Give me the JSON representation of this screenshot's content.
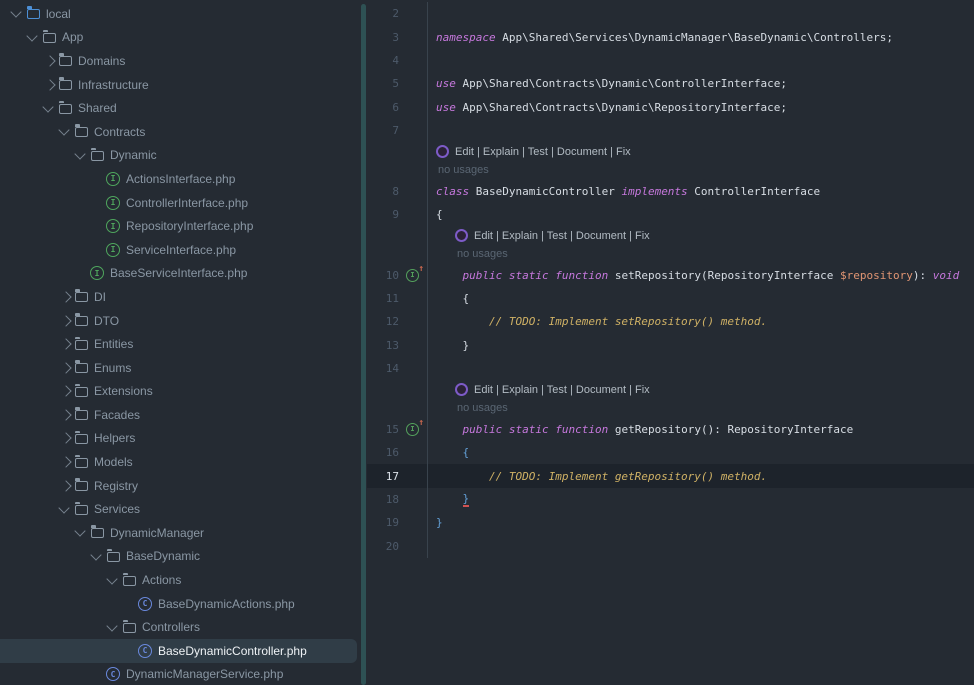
{
  "colors": {
    "background": "#252b33",
    "selection_row": "#303d47",
    "current_line": "#1d232b",
    "keyword": "#c678dd",
    "plain_code": "#d7dde4",
    "todo_comment": "#cfb165",
    "variable": "#e09573",
    "matched_brace": "#64a1d8",
    "error_underline": "#d15252",
    "interface_icon": "#4fa65d",
    "class_icon": "#6a89dd",
    "blue_folder": "#4c8fd6",
    "splitter": "#2e5154"
  },
  "project_tree": {
    "items": [
      {
        "label": "local",
        "kind": "folder",
        "icon": "folder-blue",
        "level": 0,
        "state": "expanded",
        "selected": false
      },
      {
        "label": "App",
        "kind": "folder",
        "icon": "folder",
        "level": 1,
        "state": "expanded",
        "selected": false
      },
      {
        "label": "Domains",
        "kind": "folder",
        "icon": "folder",
        "level": 2,
        "state": "collapsed",
        "selected": false
      },
      {
        "label": "Infrastructure",
        "kind": "folder",
        "icon": "folder",
        "level": 2,
        "state": "collapsed",
        "selected": false
      },
      {
        "label": "Shared",
        "kind": "folder",
        "icon": "folder",
        "level": 2,
        "state": "expanded",
        "selected": false
      },
      {
        "label": "Contracts",
        "kind": "folder",
        "icon": "folder",
        "level": 3,
        "state": "expanded",
        "selected": false
      },
      {
        "label": "Dynamic",
        "kind": "folder",
        "icon": "folder",
        "level": 4,
        "state": "expanded",
        "selected": false
      },
      {
        "label": "ActionsInterface.php",
        "kind": "file",
        "icon": "interface",
        "level": 5,
        "selected": false
      },
      {
        "label": "ControllerInterface.php",
        "kind": "file",
        "icon": "interface",
        "level": 5,
        "selected": false
      },
      {
        "label": "RepositoryInterface.php",
        "kind": "file",
        "icon": "interface",
        "level": 5,
        "selected": false
      },
      {
        "label": "ServiceInterface.php",
        "kind": "file",
        "icon": "interface",
        "level": 5,
        "selected": false
      },
      {
        "label": "BaseServiceInterface.php",
        "kind": "file",
        "icon": "interface",
        "level": 4,
        "selected": false
      },
      {
        "label": "DI",
        "kind": "folder",
        "icon": "folder",
        "level": 3,
        "state": "collapsed",
        "selected": false
      },
      {
        "label": "DTO",
        "kind": "folder",
        "icon": "folder",
        "level": 3,
        "state": "collapsed",
        "selected": false
      },
      {
        "label": "Entities",
        "kind": "folder",
        "icon": "folder",
        "level": 3,
        "state": "collapsed",
        "selected": false
      },
      {
        "label": "Enums",
        "kind": "folder",
        "icon": "folder",
        "level": 3,
        "state": "collapsed",
        "selected": false
      },
      {
        "label": "Extensions",
        "kind": "folder",
        "icon": "folder",
        "level": 3,
        "state": "collapsed",
        "selected": false
      },
      {
        "label": "Facades",
        "kind": "folder",
        "icon": "folder",
        "level": 3,
        "state": "collapsed",
        "selected": false
      },
      {
        "label": "Helpers",
        "kind": "folder",
        "icon": "folder",
        "level": 3,
        "state": "collapsed",
        "selected": false
      },
      {
        "label": "Models",
        "kind": "folder",
        "icon": "folder",
        "level": 3,
        "state": "collapsed",
        "selected": false
      },
      {
        "label": "Registry",
        "kind": "folder",
        "icon": "folder",
        "level": 3,
        "state": "collapsed",
        "selected": false
      },
      {
        "label": "Services",
        "kind": "folder",
        "icon": "folder",
        "level": 3,
        "state": "expanded",
        "selected": false
      },
      {
        "label": "DynamicManager",
        "kind": "folder",
        "icon": "folder",
        "level": 4,
        "state": "expanded",
        "selected": false
      },
      {
        "label": "BaseDynamic",
        "kind": "folder",
        "icon": "folder",
        "level": 5,
        "state": "expanded",
        "selected": false
      },
      {
        "label": "Actions",
        "kind": "folder",
        "icon": "folder",
        "level": 6,
        "state": "expanded",
        "selected": false
      },
      {
        "label": "BaseDynamicActions.php",
        "kind": "file",
        "icon": "class",
        "level": 7,
        "selected": false
      },
      {
        "label": "Controllers",
        "kind": "folder",
        "icon": "folder",
        "level": 6,
        "state": "expanded",
        "selected": false
      },
      {
        "label": "BaseDynamicController.php",
        "kind": "file",
        "icon": "class",
        "level": 7,
        "selected": true
      },
      {
        "label": "DynamicManagerService.php",
        "kind": "file",
        "icon": "class",
        "level": 5,
        "selected": false
      }
    ]
  },
  "editor": {
    "ai_actions_hint": "Edit | Explain | Test | Document | Fix",
    "usages_hint": "no usages",
    "rows": [
      {
        "kind": "code",
        "num": "2",
        "tokens": []
      },
      {
        "kind": "code",
        "num": "3",
        "tokens": [
          [
            "kw",
            "namespace"
          ],
          [
            "pl",
            " App\\Shared\\Services\\DynamicManager\\BaseDynamic\\Controllers;"
          ]
        ]
      },
      {
        "kind": "code",
        "num": "4",
        "tokens": []
      },
      {
        "kind": "code",
        "num": "5",
        "tokens": [
          [
            "kw",
            "use"
          ],
          [
            "pl",
            " App\\Shared\\Contracts\\Dynamic\\ControllerInterface;"
          ]
        ]
      },
      {
        "kind": "code",
        "num": "6",
        "tokens": [
          [
            "kw",
            "use"
          ],
          [
            "pl",
            " App\\Shared\\Contracts\\Dynamic\\RepositoryInterface;"
          ]
        ]
      },
      {
        "kind": "code",
        "num": "7",
        "tokens": []
      },
      {
        "kind": "inlay",
        "indent": 0
      },
      {
        "kind": "usages",
        "indent": 0
      },
      {
        "kind": "code",
        "num": "8",
        "tokens": [
          [
            "kw",
            "class"
          ],
          [
            "pl",
            " BaseDynamicController "
          ],
          [
            "kw",
            "implements"
          ],
          [
            "pl",
            " ControllerInterface"
          ]
        ]
      },
      {
        "kind": "code",
        "num": "9",
        "tokens": [
          [
            "pl",
            "{"
          ]
        ]
      },
      {
        "kind": "inlay",
        "indent": 1
      },
      {
        "kind": "usages",
        "indent": 1
      },
      {
        "kind": "code",
        "num": "10",
        "gutter_icon": "implements",
        "tokens": [
          [
            "pl",
            "    "
          ],
          [
            "kw",
            "public"
          ],
          [
            "pl",
            " "
          ],
          [
            "kw",
            "static"
          ],
          [
            "pl",
            " "
          ],
          [
            "kw",
            "function"
          ],
          [
            "pl",
            " setRepository(RepositoryInterface "
          ],
          [
            "var",
            "$repository"
          ],
          [
            "pl",
            "): "
          ],
          [
            "kw",
            "void"
          ]
        ]
      },
      {
        "kind": "code",
        "num": "11",
        "tokens": [
          [
            "pl",
            "    {"
          ]
        ]
      },
      {
        "kind": "code",
        "num": "12",
        "tokens": [
          [
            "pl",
            "        "
          ],
          [
            "todo",
            "// TODO: Implement setRepository() method."
          ]
        ]
      },
      {
        "kind": "code",
        "num": "13",
        "tokens": [
          [
            "pl",
            "    }"
          ]
        ]
      },
      {
        "kind": "code",
        "num": "14",
        "tokens": []
      },
      {
        "kind": "inlay",
        "indent": 1
      },
      {
        "kind": "usages",
        "indent": 1
      },
      {
        "kind": "code",
        "num": "15",
        "gutter_icon": "implements",
        "tokens": [
          [
            "pl",
            "    "
          ],
          [
            "kw",
            "public"
          ],
          [
            "pl",
            " "
          ],
          [
            "kw",
            "static"
          ],
          [
            "pl",
            " "
          ],
          [
            "kw",
            "function"
          ],
          [
            "pl",
            " getRepository(): RepositoryInterface"
          ]
        ]
      },
      {
        "kind": "code",
        "num": "16",
        "tokens": [
          [
            "pl",
            "    "
          ],
          [
            "brace",
            "{"
          ]
        ]
      },
      {
        "kind": "code",
        "num": "17",
        "current": true,
        "tokens": [
          [
            "pl",
            "        "
          ],
          [
            "todo",
            "// TODO: Implement getRepository() method."
          ]
        ]
      },
      {
        "kind": "code",
        "num": "18",
        "tokens": [
          [
            "pl",
            "    "
          ],
          [
            "brace-err",
            "}"
          ]
        ]
      },
      {
        "kind": "code",
        "num": "19",
        "tokens": [
          [
            "brace",
            "}"
          ]
        ]
      },
      {
        "kind": "code",
        "num": "20",
        "tokens": []
      }
    ]
  }
}
